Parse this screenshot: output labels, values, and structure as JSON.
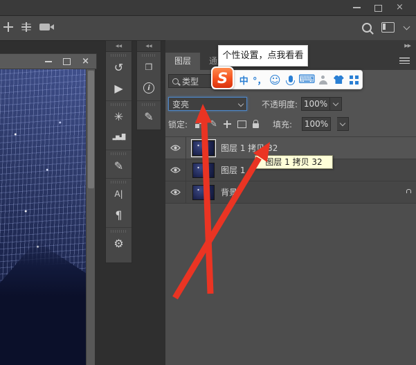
{
  "window": {
    "minimize": "minimize",
    "restore": "restore",
    "close_glyph": "×"
  },
  "doc_window": {
    "close_glyph": "×"
  },
  "layers_panel": {
    "tabs": [
      {
        "label": "图层",
        "active": true
      },
      {
        "label": "通道",
        "active": false
      }
    ],
    "expand_glyph": "▶▶",
    "filter_label": "类型",
    "blend_mode": "变亮",
    "opacity_label": "不透明度:",
    "opacity_value": "100%",
    "lock_label": "锁定:",
    "fill_label": "填充:",
    "fill_value": "100%",
    "rows": [
      {
        "name": "图层 1 拷贝 32",
        "selected": true,
        "visible": true
      },
      {
        "name": "图层 1",
        "selected": false,
        "visible": true
      },
      {
        "name": "背景",
        "selected": false,
        "visible": true,
        "locked": true
      }
    ]
  },
  "tool_strips": {
    "collapse_glyph": "◀◀",
    "icons": {
      "history": "↺",
      "actions": "▶",
      "styles_wheel": "✳",
      "histogram": "▂▅▃▇",
      "brush_settings": "✎",
      "character": "A|",
      "paragraph": "¶",
      "share": "⚙",
      "layer_comps": "❒",
      "info": "i",
      "brush_presets": "✎"
    }
  },
  "overlays": {
    "ime_tooltip": "个性设置，点我看看",
    "layer_tooltip": "图层 1 拷贝 32",
    "sogou_bar": {
      "logo": "S",
      "mode": "中",
      "punctuation": "°，",
      "smiley": "☺",
      "keyboard": "⌨"
    }
  },
  "colors": {
    "accent_blue": "#4e86c8",
    "arrow_red": "#ea3423",
    "sogou_blue": "#2a7fd4",
    "sogou_red": "#e62f17",
    "tooltip_yellow_bg": "#ffffd8",
    "panel_bg": "#535353"
  }
}
